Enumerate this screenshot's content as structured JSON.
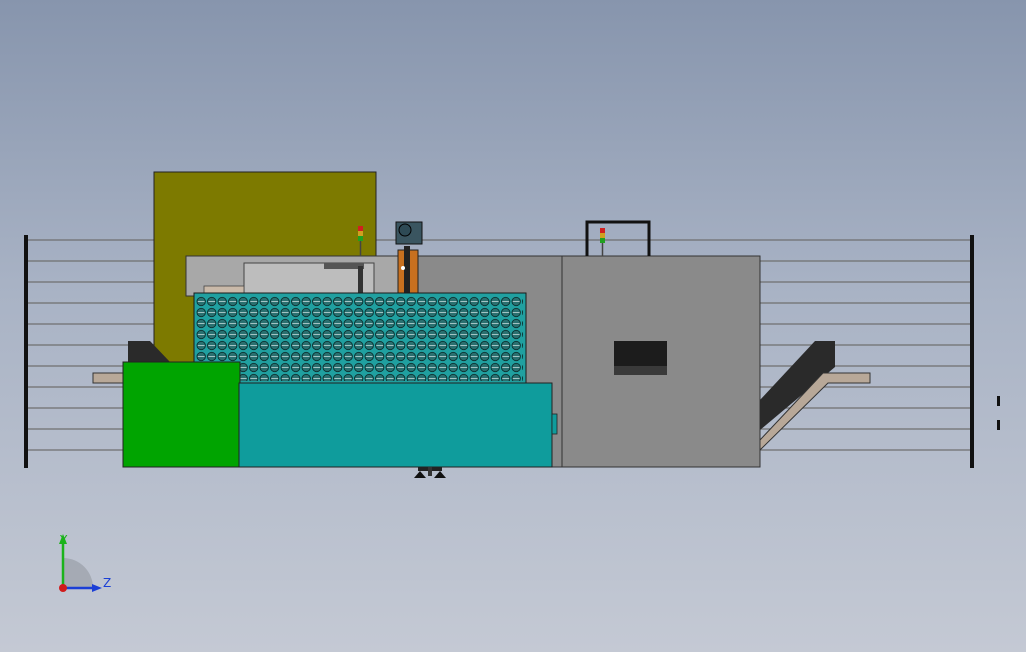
{
  "viewport": {
    "background_top": "#8795ad",
    "background_bottom": "#c4c9d4"
  },
  "machine": {
    "hopper_color": "#7d7a00",
    "green_module_color": "#00a400",
    "teal_module_color": "#0f9c9c",
    "gray_body_color": "#8a8a8a",
    "perforated_panel_color": "#20a0a0",
    "conveyor_color": "#b8a898",
    "chute_color": "#2a2a2a"
  },
  "triad": {
    "y_label": "Y",
    "z_label": "Z",
    "y_color": "#1bb31b",
    "z_color": "#1b3fd6",
    "x_color": "#d01b1b"
  }
}
